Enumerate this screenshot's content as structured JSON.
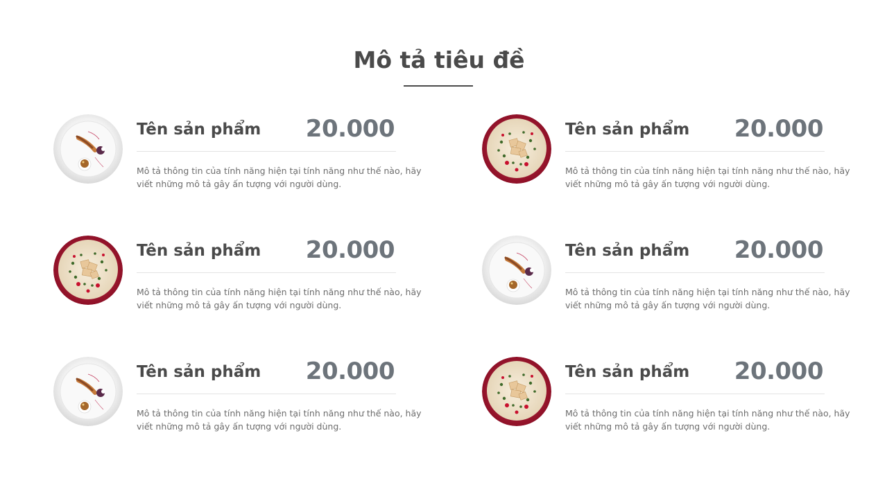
{
  "section": {
    "title": "Mô tả tiêu đề"
  },
  "items": [
    {
      "name": "Tên sản phẩm",
      "price": "20.000",
      "desc_line1": "Mô tả thông tin của tính năng hiện tại tính năng như thế nào, hãy",
      "desc_line2": "viết những mô tả gây ấn tượng với người dùng.",
      "image": "white-plate-dish"
    },
    {
      "name": "Tên sản phẩm",
      "price": "20.000",
      "desc_line1": "Mô tả thông tin của tính năng hiện tại tính năng như thế nào, hãy",
      "desc_line2": "viết những mô tả gây ấn tượng với người dùng.",
      "image": "red-plate-dish"
    },
    {
      "name": "Tên sản phẩm",
      "price": "20.000",
      "desc_line1": "Mô tả thông tin của tính năng hiện tại tính năng như thế nào, hãy",
      "desc_line2": "viết những mô tả gây ấn tượng với người dùng.",
      "image": "red-plate-dish"
    },
    {
      "name": "Tên sản phẩm",
      "price": "20.000",
      "desc_line1": "Mô tả thông tin của tính năng hiện tại tính năng như thế nào, hãy",
      "desc_line2": "viết những mô tả gây ấn tượng với người dùng.",
      "image": "white-plate-dish"
    },
    {
      "name": "Tên sản phẩm",
      "price": "20.000",
      "desc_line1": "Mô tả thông tin của tính năng hiện tại tính năng như thế nào, hãy",
      "desc_line2": "viết những mô tả gây ấn tượng với người dùng.",
      "image": "white-plate-dish"
    },
    {
      "name": "Tên sản phẩm",
      "price": "20.000",
      "desc_line1": "Mô tả thông tin của tính năng hiện tại tính năng như thế nào, hãy",
      "desc_line2": "viết những mô tả gây ấn tượng với người dùng.",
      "image": "red-plate-dish"
    }
  ],
  "colors": {
    "title": "#4a4a4a",
    "price": "#6d747b",
    "divider": "#e3e3e3",
    "red_plate": "#a3172f"
  }
}
